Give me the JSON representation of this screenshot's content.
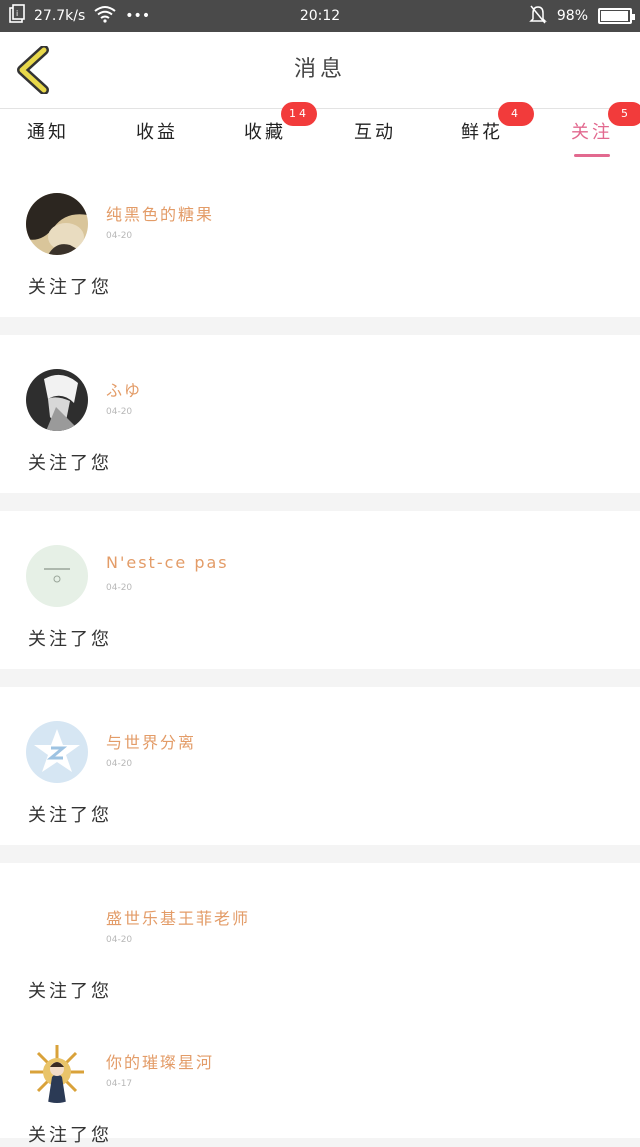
{
  "status_bar": {
    "speed": "27.7k/s",
    "dots": "•••",
    "time": "20:12",
    "battery": "98%",
    "battery_level": 0.98
  },
  "header": {
    "title": "消息"
  },
  "tabs": [
    {
      "label": "通知",
      "badge": ""
    },
    {
      "label": "收益",
      "badge": ""
    },
    {
      "label": "收藏",
      "badge": "14"
    },
    {
      "label": "互动",
      "badge": ""
    },
    {
      "label": "鲜花",
      "badge": "4"
    },
    {
      "label": "关注",
      "badge": "5"
    }
  ],
  "active_tab": "关注",
  "messages": [
    {
      "name": "纯黑色的糖果",
      "date": "04-20",
      "action": "关注了您"
    },
    {
      "name": "ふゆ",
      "date": "04-20",
      "action": "关注了您"
    },
    {
      "name": "N'est-ce pas",
      "date": "04-20",
      "action": "关注了您"
    },
    {
      "name": "与世界分离",
      "date": "04-20",
      "action": "关注了您"
    },
    {
      "name": "盛世乐基王菲老师",
      "date": "04-20",
      "action": "关注了您"
    },
    {
      "name": "你的璀璨星河",
      "date": "04-17",
      "action": "关注了您"
    }
  ],
  "colors": {
    "accent": "#e2698f",
    "badge": "#f23b3b",
    "username": "#e39c68",
    "back_arrow": "#e8d84a"
  }
}
